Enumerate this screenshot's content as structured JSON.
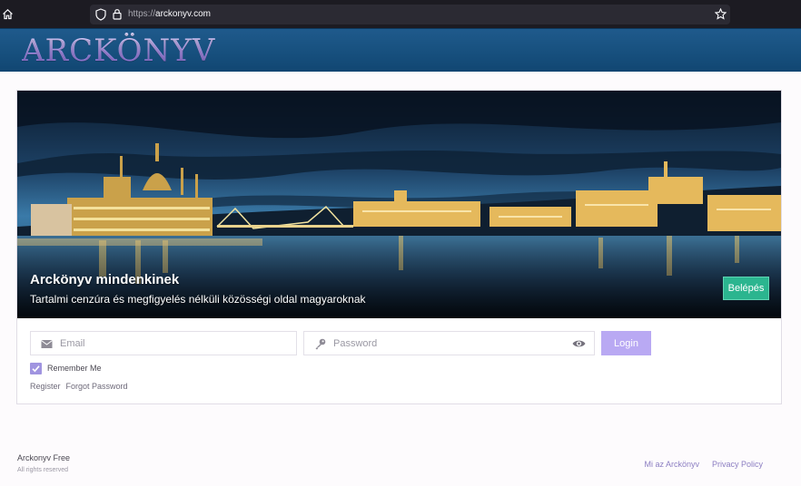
{
  "browser": {
    "url_scheme": "https://",
    "url_host": "arckonyv.com",
    "icons": [
      "home-icon",
      "shield-icon",
      "lock-icon",
      "star-icon"
    ]
  },
  "header": {
    "logo_text": "ARCKÖNYV"
  },
  "hero": {
    "title": "Arckönyv mindenkinek",
    "subtitle": "Tartalmi cenzúra és megfigyelés nélküli közösségi oldal magyaroknak",
    "enter_button": "Belépés"
  },
  "login_form": {
    "email_placeholder": "Email",
    "email_value": "",
    "password_placeholder": "Password",
    "password_value": "",
    "login_button": "Login",
    "remember_label": "Remember Me",
    "remember_checked": true,
    "register_link": "Register",
    "forgot_link": "Forgot Password",
    "icons": [
      "envelope-icon",
      "key-icon",
      "eye-icon",
      "checkmark-icon"
    ]
  },
  "footer": {
    "brand": "Arckonyv Free",
    "rights": "All rights reserved",
    "links": [
      "Mi az Arckönyv",
      "Privacy Policy"
    ]
  },
  "colors": {
    "header_bg": "#17507e",
    "logo": "#b8a6f0",
    "enter_button": "#2bb58f",
    "login_button": "#b9a9f3",
    "checkbox": "#a094e0",
    "footer_link": "#8c7ec2"
  }
}
